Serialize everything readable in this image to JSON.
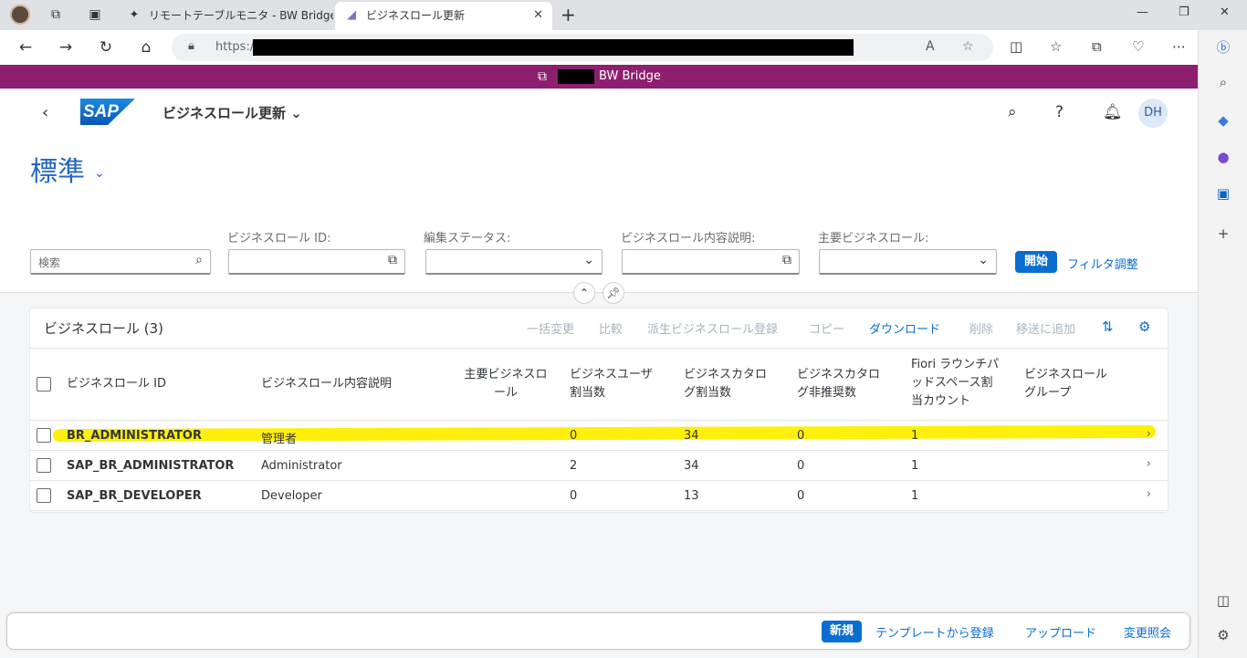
{
  "browser": {
    "tabs": [
      {
        "label": "リモートテーブルモニタ - BW Bridge (S"
      },
      {
        "label": "ビジネスロール更新"
      }
    ],
    "url_scheme": "https://"
  },
  "shell": {
    "title": "BW Bridge"
  },
  "app": {
    "title": "ビジネスロール更新",
    "user_initials": "DH",
    "variant": "標準"
  },
  "filters": {
    "search_placeholder": "検索",
    "labels": [
      "ビジネスロール ID:",
      "編集ステータス:",
      "ビジネスロール内容説明:",
      "主要ビジネスロール:"
    ],
    "go": "開始",
    "adapt": "フィルタ調整"
  },
  "table": {
    "title": "ビジネスロール (3)",
    "toolbar": [
      "一括変更",
      "比較",
      "派生ビジネスロール登録",
      "コピー",
      "ダウンロード",
      "削除",
      "移送に追加"
    ],
    "columns": [
      [
        "ビジネスロール ID"
      ],
      [
        "ビジネスロール内容説明"
      ],
      [
        "主要ビジネスロ",
        "ール"
      ],
      [
        "ビジネスユーザ",
        "割当数"
      ],
      [
        "ビジネスカタロ",
        "グ割当数"
      ],
      [
        "ビジネスカタロ",
        "グ非推奨数"
      ],
      [
        "Fiori ラウンチパ",
        "ッドスペース割",
        "当カウント"
      ],
      [
        "ビジネスロール",
        "グループ"
      ]
    ],
    "rows": [
      {
        "id": "BR_ADMINISTRATOR",
        "desc": "管理者",
        "users": "0",
        "catalogs": "34",
        "deprecated": "0",
        "spaces": "1"
      },
      {
        "id": "SAP_BR_ADMINISTRATOR",
        "desc": "Administrator",
        "users": "2",
        "catalogs": "34",
        "deprecated": "0",
        "spaces": "1"
      },
      {
        "id": "SAP_BR_DEVELOPER",
        "desc": "Developer",
        "users": "0",
        "catalogs": "13",
        "deprecated": "0",
        "spaces": "1"
      }
    ]
  },
  "footer": {
    "new": "新規",
    "template": "テンプレートから登録",
    "upload": "アップロード",
    "changes": "変更照会"
  },
  "colors": {
    "shell": "#8d1f6e",
    "accent": "#0a6ed1",
    "highlight": "#ffee00"
  }
}
